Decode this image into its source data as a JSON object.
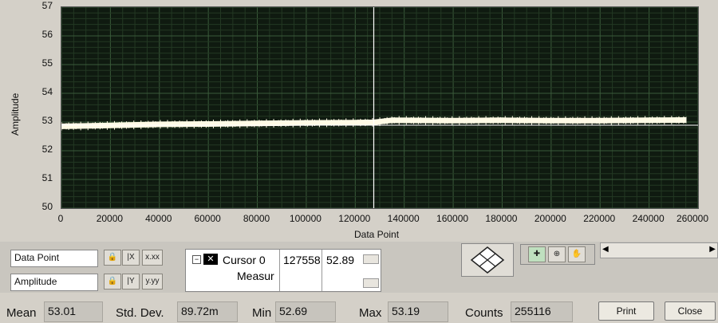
{
  "chart_data": {
    "type": "line",
    "xlabel": "Data Point",
    "ylabel": "Amplitude",
    "xlim": [
      0,
      260000
    ],
    "ylim": [
      50,
      57
    ],
    "x_ticks": [
      "0",
      "20000",
      "40000",
      "60000",
      "80000",
      "100000",
      "120000",
      "140000",
      "160000",
      "180000",
      "200000",
      "220000",
      "240000",
      "260000"
    ],
    "y_ticks": [
      "50",
      "51",
      "52",
      "53",
      "54",
      "55",
      "56",
      "57"
    ],
    "grid": true,
    "series": [
      {
        "x": [
          0,
          20000,
          40000,
          60000,
          80000,
          100000,
          120000,
          127558,
          135000,
          160000,
          180000,
          200000,
          220000,
          240000,
          255116
        ],
        "y": [
          52.85,
          52.88,
          52.92,
          52.93,
          52.95,
          52.97,
          52.98,
          52.99,
          53.06,
          53.05,
          53.06,
          53.05,
          53.05,
          53.06,
          53.07
        ]
      }
    ],
    "cursor": {
      "x": 127558,
      "y": 52.89
    },
    "colors": {
      "background": "#0f1a10",
      "grid": "#3a5a3a",
      "trace": "#fffbe6",
      "cursor": "#ffffff"
    }
  },
  "axis_controls": {
    "x_name": "Data Point",
    "y_name": "Amplitude",
    "x_format_label": "x.xx",
    "y_format_label": "y.yy"
  },
  "cursor_panel": {
    "name": "Cursor 0",
    "x_value": "127558",
    "y_value": "52.89",
    "sub_label": "Measur"
  },
  "stats": {
    "mean_label": "Mean",
    "mean_value": "53.01",
    "std_label": "Std. Dev.",
    "std_value": "89.72m",
    "min_label": "Min",
    "min_value": "52.69",
    "max_label": "Max",
    "max_value": "53.19",
    "counts_label": "Counts",
    "counts_value": "255116"
  },
  "buttons": {
    "print": "Print",
    "close": "Close"
  }
}
